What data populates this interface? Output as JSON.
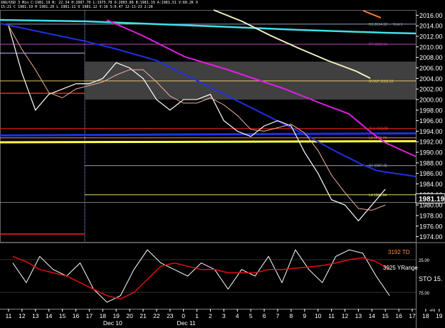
{
  "header": {
    "line1": "XAU/USD 3 Min  C:1981.19  N:  22.34  H:2007.70  L:1975.78  O:2003.80  B:1981.19  A:1981.51  V:60.2K  O",
    "line2": "15:21 C 1981.19 H 1981.20 L 1981.11 O 1981.12 V:16 S:0.47 12-11-23 2:26"
  },
  "price_axis": {
    "ticks": [
      "2016.00",
      "2014.00",
      "2012.00",
      "2010.00",
      "2008.00",
      "2006.00",
      "2004.00",
      "2002.00",
      "2000.00",
      "1998.00",
      "1996.00",
      "1994.00",
      "1992.00",
      "1990.00",
      "1988.00",
      "1986.00",
      "1984.00",
      "1982.00",
      "1980.00",
      "1978.00",
      "1976.00",
      "1974.00"
    ],
    "last_price": "1981.19"
  },
  "levels": [
    {
      "label": "R3",
      "value_text": "2014.32",
      "extra": "Yest 1",
      "color": "#9aa0b8"
    },
    {
      "label": "PP",
      "value_text": "2010.50",
      "color": "#c040c0"
    },
    {
      "label": "RVWP",
      "value_text": "2003.53",
      "color": "#e0c060"
    },
    {
      "label": "TLU",
      "value_text": "Ch1/08",
      "color": "#ff4040"
    },
    {
      "label": "L3",
      "value_text": "1992.74",
      "color": "#ff9040"
    },
    {
      "label": "S1",
      "value_text": "1987.48",
      "color": "#9aa0b8"
    },
    {
      "label": "L4",
      "value_text": "1981.94",
      "color": "#e0e060"
    }
  ],
  "indicator": {
    "td_label": "3192 TD",
    "yrange_label": "3925 YRange",
    "sto_label": "STO 15.",
    "tick_25": "25.00",
    "tick_75": "75.00",
    "tick_50": "+Fil"
  },
  "time_axis": {
    "hours": [
      "11",
      "12",
      "13",
      "14",
      "15",
      "16",
      "17",
      "18",
      "19",
      "20",
      "21",
      "22",
      "23",
      "0",
      "1",
      "2",
      "3",
      "4",
      "5",
      "6",
      "7",
      "8",
      "9",
      "10",
      "11",
      "12",
      "13",
      "14",
      "15",
      "16",
      "17",
      "18",
      "19"
    ],
    "dates": [
      "Dec 10",
      "Dec 11"
    ]
  },
  "colors": {
    "background": "#000000",
    "price": "#ffffff",
    "cyan_ma": "#40e0e8",
    "blue_ma": "#2030e0",
    "magenta_ma": "#e020e0",
    "cream_ma": "#f0f0c0",
    "pink_ma": "#f0b0a0",
    "red_level": "#ff2020",
    "yellow_level": "#ffff40",
    "sto_red": "#e01010",
    "sto_white": "#ffffff"
  },
  "chart_data": [
    {
      "type": "line",
      "title": "XAU/USD 3 Min",
      "x": [
        "11",
        "12",
        "13",
        "14",
        "15",
        "16",
        "17",
        "18",
        "19",
        "20",
        "21",
        "22",
        "23",
        "0",
        "1",
        "2",
        "3",
        "4",
        "5",
        "6",
        "7",
        "8",
        "9",
        "10",
        "11",
        "12",
        "13",
        "14",
        "15"
      ],
      "series": [
        {
          "values": [
            2014,
            2005,
            1998,
            2001,
            2002,
            2003,
            2003,
            2004,
            2007,
            2006,
            2004,
            2000,
            1998,
            2000,
            2000,
            2001,
            1996,
            1994,
            1993,
            1995,
            1996,
            1995,
            1990,
            1986,
            1981,
            1980,
            1977,
            1980,
            1983
          ]
        }
      ],
      "ylim": [
        1973,
        2017
      ]
    },
    {
      "type": "line",
      "title": "STO",
      "x": [
        "11",
        "12",
        "13",
        "14",
        "15",
        "16",
        "17",
        "18",
        "19",
        "20",
        "21",
        "22",
        "23",
        "0",
        "1",
        "2",
        "3",
        "4",
        "5",
        "6",
        "7",
        "8",
        "9",
        "10",
        "11",
        "12",
        "13",
        "14",
        "15"
      ],
      "series": [
        {
          "values": [
            70,
            40,
            80,
            60,
            50,
            70,
            30,
            10,
            20,
            60,
            90,
            70,
            60,
            50,
            70,
            60,
            30,
            60,
            50,
            80,
            40,
            90,
            60,
            40,
            80,
            90,
            85,
            50,
            20
          ]
        },
        {
          "values": [
            80,
            72,
            60,
            55,
            50,
            40,
            30,
            20,
            15,
            25,
            45,
            65,
            70,
            65,
            60,
            60,
            55,
            55,
            55,
            60,
            60,
            62,
            64,
            66,
            70,
            75,
            78,
            72,
            60
          ]
        }
      ],
      "ylim": [
        0,
        100
      ]
    }
  ]
}
